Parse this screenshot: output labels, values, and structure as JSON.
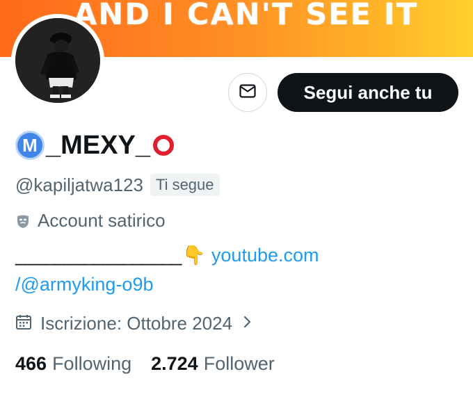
{
  "banner": {
    "text": "AND I CAN'T SEE IT",
    "colors": [
      "#ff6a1a",
      "#ffd02e"
    ]
  },
  "profile": {
    "avatar_icon": "avatar",
    "message_icon": "envelope-icon",
    "follow_label": "Segui anche tu",
    "badge_letter": "M",
    "display_name": "_MEXY_",
    "handle": "@kapiljatwa123",
    "follows_you": "Ti segue",
    "satire_label": "Account satirico",
    "bio_underscores": "_________________",
    "bio_emoji": "👇",
    "bio_link_part1": "youtube.com",
    "bio_link_part2": "/@armyking-o9b",
    "joined": "Iscrizione: Ottobre 2024",
    "following_count": "466",
    "following_label": "Following",
    "followers_count": "2.724",
    "followers_label": "Follower"
  },
  "colors": {
    "link": "#1d9bf0",
    "secondary_text": "#536471",
    "button_bg": "#0f1419",
    "badge_blue": "#3f86e8",
    "ring_red": "#e0202e"
  }
}
